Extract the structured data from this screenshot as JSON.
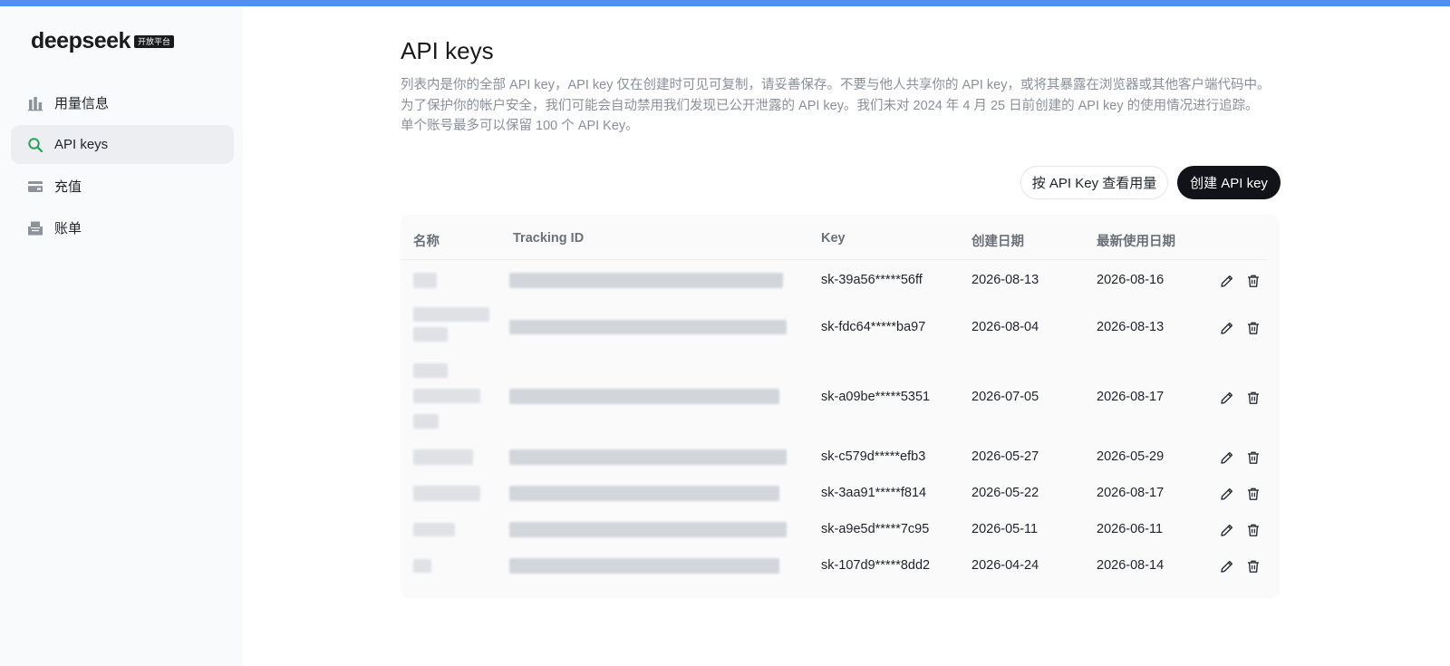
{
  "brand": {
    "name": "deepseek",
    "badge": "开放平台"
  },
  "nav": {
    "items": [
      {
        "label": "用量信息",
        "icon": "bar-chart-icon",
        "active": false
      },
      {
        "label": "API keys",
        "icon": "search-icon",
        "active": true
      },
      {
        "label": "充值",
        "icon": "wallet-icon",
        "active": false
      },
      {
        "label": "账单",
        "icon": "inbox-icon",
        "active": false
      }
    ]
  },
  "page": {
    "title": "API keys",
    "description": [
      "列表内是你的全部 API key，API key 仅在创建时可见可复制，请妥善保存。不要与他人共享你的 API key，或将其暴露在浏览器或其他客户端代码中。",
      "为了保护你的帐户安全，我们可能会自动禁用我们发现已公开泄露的 API key。我们未对 2024 年 4 月 25 日前创建的 API key 的使用情况进行追踪。",
      "单个账号最多可以保留 100 个 API Key。"
    ]
  },
  "actions": {
    "usage_by_key": "按 API Key 查看用量",
    "create_key": "创建 API key"
  },
  "table": {
    "headers": {
      "name": "名称",
      "tracking_id": "Tracking ID",
      "key": "Key",
      "created": "创建日期",
      "last_used": "最新使用日期"
    },
    "rows": [
      {
        "key": "sk-39a56*****56ff",
        "created": "2026-08-13",
        "last_used": "2026-08-16"
      },
      {
        "key": "sk-fdc64*****ba97",
        "created": "2026-08-04",
        "last_used": "2026-08-13"
      },
      {
        "key": "sk-a09be*****5351",
        "created": "2026-07-05",
        "last_used": "2026-08-17"
      },
      {
        "key": "sk-c579d*****efb3",
        "created": "2026-05-27",
        "last_used": "2026-05-29"
      },
      {
        "key": "sk-3aa91*****f814",
        "created": "2026-05-22",
        "last_used": "2026-08-17"
      },
      {
        "key": "sk-a9e5d*****7c95",
        "created": "2026-05-11",
        "last_used": "2026-06-11"
      },
      {
        "key": "sk-107d9*****8dd2",
        "created": "2026-04-24",
        "last_used": "2026-08-14"
      }
    ]
  },
  "colors": {
    "accent_bar": "#4d8ef7",
    "active_icon": "#23a455",
    "primary_button": "#111318"
  }
}
